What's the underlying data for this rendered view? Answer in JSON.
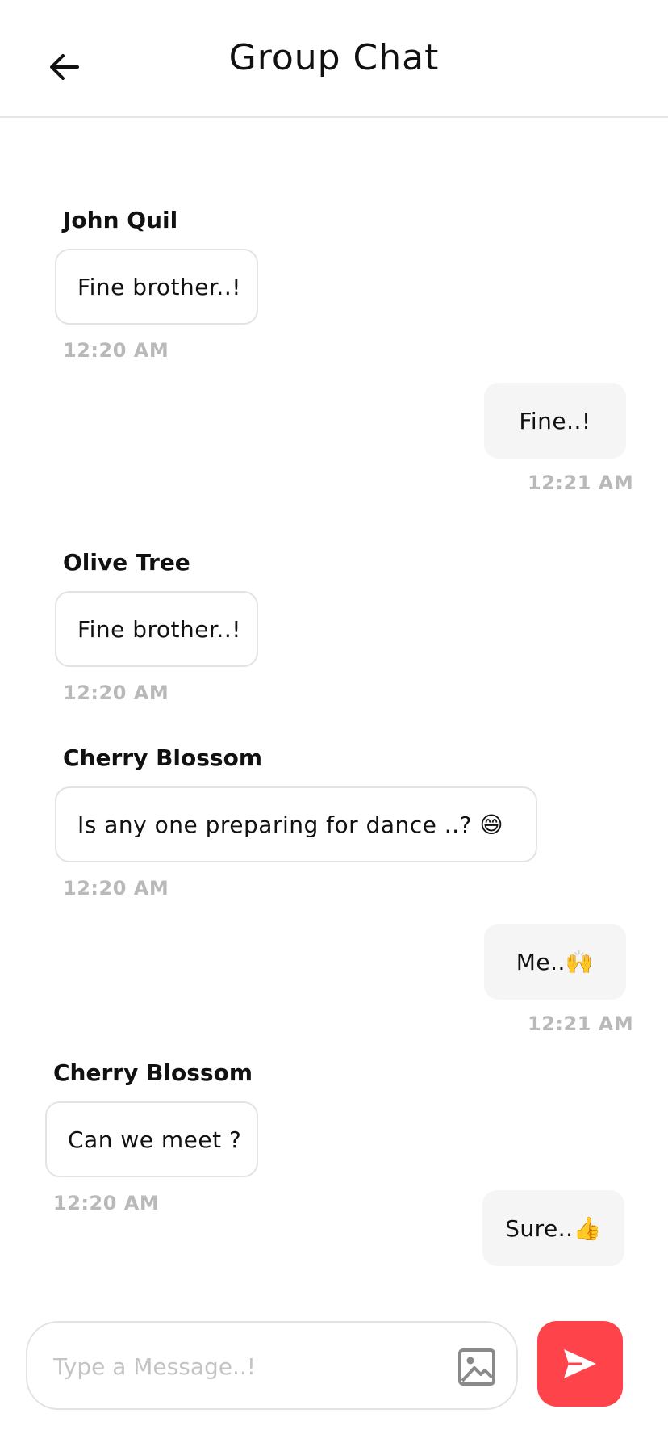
{
  "header": {
    "title": "Group Chat"
  },
  "messages": [
    {
      "sender": "John Quil",
      "text": "Fine brother..!",
      "time": "12:20 AM"
    },
    {
      "text": "Fine..!",
      "time": "12:21 AM"
    },
    {
      "sender": "Olive Tree",
      "text": "Fine brother..!",
      "time": "12:20 AM"
    },
    {
      "sender": "Cherry Blossom",
      "text": "Is any one preparing for dance ..?  😄",
      "time": "12:20 AM"
    },
    {
      "text": "Me..🙌",
      "time": "12:21 AM"
    },
    {
      "sender": "Cherry Blossom",
      "text": "Can we meet ?",
      "time": "12:20 AM"
    },
    {
      "text": "Sure..👍"
    }
  ],
  "composer": {
    "placeholder": "Type a Message..!"
  },
  "icons": {
    "back": "arrow-left-icon",
    "image": "image-icon",
    "send": "send-icon"
  },
  "colors": {
    "accent": "#ff434a",
    "outgoing_bubble": "#f5f5f5",
    "incoming_border": "#e3e3e3",
    "timestamp": "#b9b9b9"
  }
}
